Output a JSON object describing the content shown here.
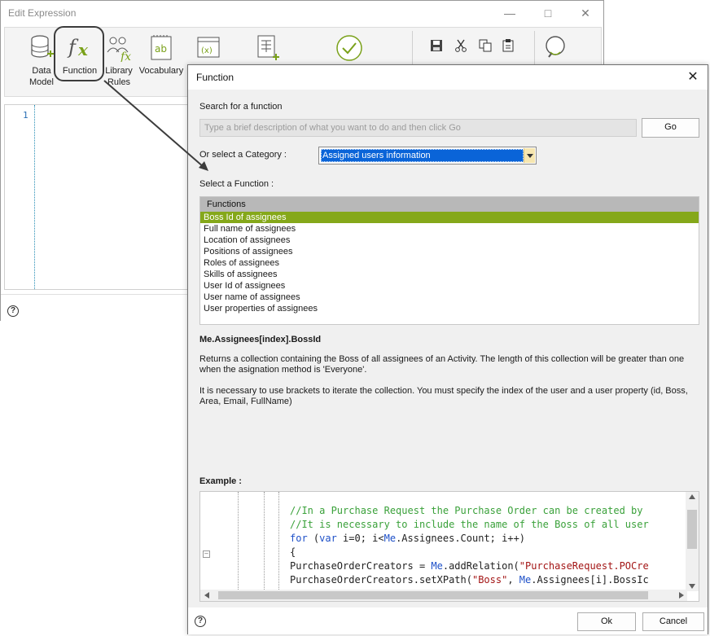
{
  "edit_expression": {
    "title": "Edit Expression",
    "ribbon": [
      {
        "name": "data-model",
        "label": "Data Model"
      },
      {
        "name": "function",
        "label": "Function"
      },
      {
        "name": "library-rules",
        "label": "Library Rules"
      },
      {
        "name": "vocabulary",
        "label": "Vocabulary"
      }
    ],
    "editor": {
      "line_number": "1"
    }
  },
  "function_dialog": {
    "title": "Function",
    "search_label": "Search for a function",
    "search_placeholder": "Type a brief description of what you want to do and then click Go",
    "go_label": "Go",
    "category_label": "Or select a Category :",
    "category_value": "Assigned users information",
    "select_label": "Select a Function :",
    "list_header": "Functions",
    "functions": [
      "Boss Id of assignees",
      "Full name of assignees",
      "Location of assignees",
      "Positions of assignees",
      "Roles of assignees",
      "Skills of assignees",
      "User Id of assignees",
      "User name of assignees",
      "User properties of assignees"
    ],
    "selected_index": 0,
    "signature": "Me.Assignees[index].BossId",
    "description_1": "Returns a collection containing the Boss of all assignees of an Activity.  The length of this collection will be greater than one when the asignation method is 'Everyone'.",
    "description_2": "It is necessary to use brackets to iterate the collection. You must specify the index of the user and a user property (id, Boss, Area, Email, FullName)",
    "example_label": "Example :",
    "code": {
      "comment_1": "//In a Purchase Request the Purchase Order can be created by",
      "comment_2": "//It is necessary to include the name of the Boss of all user",
      "for_kw": "for",
      "for_open": " (",
      "var_kw": "var",
      "for_mid": " i=0; i<",
      "me_1": "Me",
      "for_tail": ".Assignees.Count; i++)",
      "brace": "{",
      "l5_a": "PurchaseOrderCreators = ",
      "me_2": "Me",
      "l5_b": ".addRelation(",
      "l5_str": "\"PurchaseRequest.POCre",
      "l6_a": "PurchaseOrderCreators.setXPath(",
      "l6_str": "\"Boss\"",
      "l6_b": ", ",
      "me_3": "Me",
      "l6_c": ".Assignees[i].BossIc"
    },
    "ok_label": "Ok",
    "cancel_label": "Cancel"
  },
  "colors": {
    "selection": "#85a81a",
    "category_highlight": "#0a64d8",
    "comment": "#3aa13a",
    "keyword": "#1e50c8",
    "string": "#a31515"
  }
}
